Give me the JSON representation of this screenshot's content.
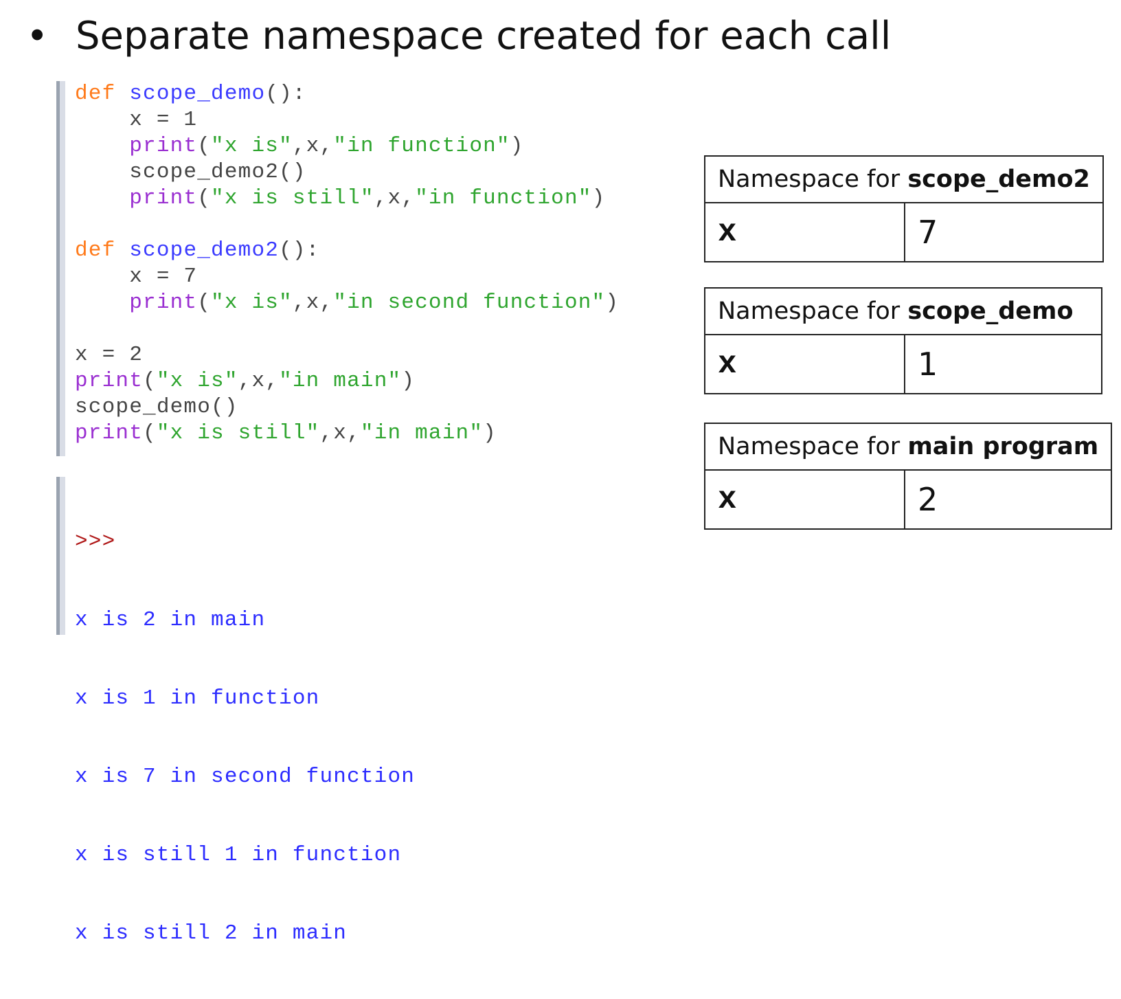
{
  "slide": {
    "bullet": "•",
    "heading": "Separate namespace created for each call"
  },
  "code": [
    [
      {
        "t": "def",
        "c": "kw"
      },
      {
        "t": " ",
        "c": "plain"
      },
      {
        "t": "scope_demo",
        "c": "fn"
      },
      {
        "t": "():",
        "c": "plain"
      }
    ],
    [
      {
        "t": "    x = 1",
        "c": "plain"
      }
    ],
    [
      {
        "t": "    ",
        "c": "plain"
      },
      {
        "t": "print",
        "c": "bi"
      },
      {
        "t": "(",
        "c": "plain"
      },
      {
        "t": "\"x is\"",
        "c": "str"
      },
      {
        "t": ",x,",
        "c": "plain"
      },
      {
        "t": "\"in function\"",
        "c": "str"
      },
      {
        "t": ")",
        "c": "plain"
      }
    ],
    [
      {
        "t": "    scope_demo2()",
        "c": "plain"
      }
    ],
    [
      {
        "t": "    ",
        "c": "plain"
      },
      {
        "t": "print",
        "c": "bi"
      },
      {
        "t": "(",
        "c": "plain"
      },
      {
        "t": "\"x is still\"",
        "c": "str"
      },
      {
        "t": ",x,",
        "c": "plain"
      },
      {
        "t": "\"in function\"",
        "c": "str"
      },
      {
        "t": ")",
        "c": "plain"
      }
    ],
    [
      {
        "t": "",
        "c": "plain"
      }
    ],
    [
      {
        "t": "def",
        "c": "kw"
      },
      {
        "t": " ",
        "c": "plain"
      },
      {
        "t": "scope_demo2",
        "c": "fn"
      },
      {
        "t": "():",
        "c": "plain"
      }
    ],
    [
      {
        "t": "    x = 7",
        "c": "plain"
      }
    ],
    [
      {
        "t": "    ",
        "c": "plain"
      },
      {
        "t": "print",
        "c": "bi"
      },
      {
        "t": "(",
        "c": "plain"
      },
      {
        "t": "\"x is\"",
        "c": "str"
      },
      {
        "t": ",x,",
        "c": "plain"
      },
      {
        "t": "\"in second function\"",
        "c": "str"
      },
      {
        "t": ")",
        "c": "plain"
      }
    ],
    [
      {
        "t": "",
        "c": "plain"
      }
    ],
    [
      {
        "t": "x = 2",
        "c": "plain"
      }
    ],
    [
      {
        "t": "print",
        "c": "bi"
      },
      {
        "t": "(",
        "c": "plain"
      },
      {
        "t": "\"x is\"",
        "c": "str"
      },
      {
        "t": ",x,",
        "c": "plain"
      },
      {
        "t": "\"in main\"",
        "c": "str"
      },
      {
        "t": ")",
        "c": "plain"
      }
    ],
    [
      {
        "t": "scope_demo()",
        "c": "plain"
      }
    ],
    [
      {
        "t": "print",
        "c": "bi"
      },
      {
        "t": "(",
        "c": "plain"
      },
      {
        "t": "\"x is still\"",
        "c": "str"
      },
      {
        "t": ",x,",
        "c": "plain"
      },
      {
        "t": "\"in main\"",
        "c": "str"
      },
      {
        "t": ")",
        "c": "plain"
      }
    ]
  ],
  "output": {
    "prompt": ">>>",
    "lines": [
      "x is 2 in main",
      "x is 1 in function",
      "x is 7 in second function",
      "x is still 1 in function",
      "x is still 2 in main"
    ]
  },
  "namespaces": [
    {
      "prefix": "Namespace for ",
      "name": "scope_demo2",
      "var": "x",
      "value": "7"
    },
    {
      "prefix": "Namespace for ",
      "name": "scope_demo",
      "var": "x",
      "value": "1"
    },
    {
      "prefix": "Namespace for ",
      "name": "main program",
      "var": "x",
      "value": "2"
    }
  ]
}
